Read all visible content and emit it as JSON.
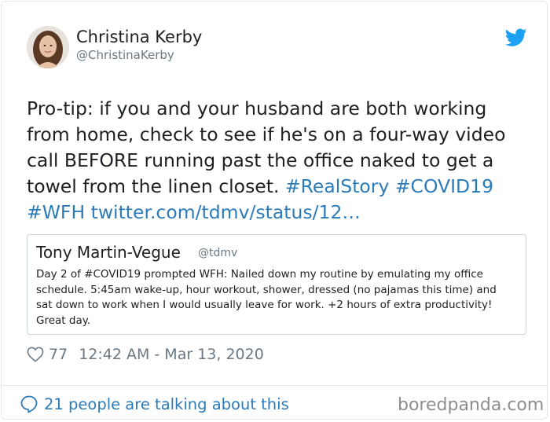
{
  "author": {
    "name": "Christina Kerby",
    "handle": "@ChristinaKerby"
  },
  "tweet": {
    "lines": [
      "Pro-tip: if you and your husband are both working",
      "from home, check to see if he's on a four-way video",
      "call BEFORE running past the office naked to get a"
    ],
    "line4_text": "towel from the linen closet. ",
    "hashtag_realstory": "#RealStory",
    "hashtag_covid": "#COVID19",
    "hashtag_wfh": "#WFH",
    "link": "twitter.com/tdmv/status/12…"
  },
  "quoted_tweet": {
    "name": "Tony Martin-Vegue",
    "handle": "@tdmv",
    "lines": [
      "Day 2 of #COVID19 prompted WFH: Nailed down my routine by emulating my office",
      "schedule. 5:45am wake-up, hour workout, shower, dressed (no pajamas this time) and",
      "sat down to work when I would usually leave for work. +2 hours of extra productivity!",
      "Great day."
    ]
  },
  "meta": {
    "likes": "77",
    "timestamp": "12:42 AM - Mar 13, 2020"
  },
  "footer": {
    "talking": "21 people are talking about this"
  },
  "watermark": "boredpanda.com",
  "icons": {
    "bird": "twitter-bird-icon",
    "heart": "heart-icon",
    "bubble": "speech-bubble-icon"
  },
  "colors": {
    "link": "#2b7bb9",
    "twitter_blue": "#1da1f2",
    "secondary_text": "#697882"
  }
}
